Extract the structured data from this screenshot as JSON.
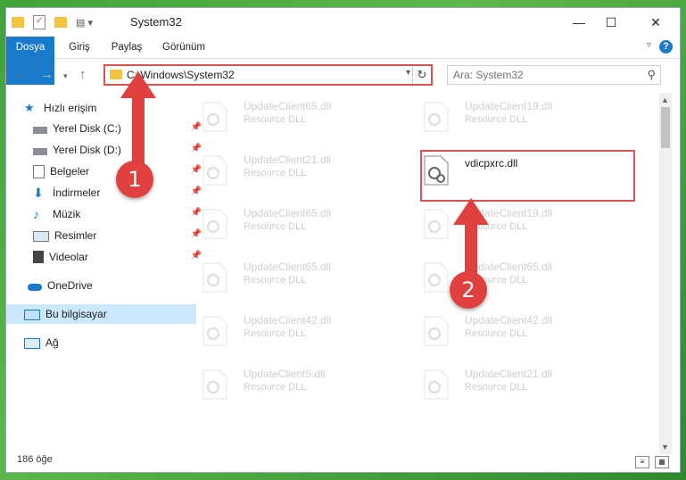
{
  "window": {
    "title": "System32",
    "minimize": "—",
    "maximize": "☐",
    "close": "✕"
  },
  "ribbon": {
    "tabs": [
      "Dosya",
      "Giriş",
      "Paylaş",
      "Görünüm"
    ],
    "help": "?"
  },
  "address": {
    "path": "C:\\Windows\\System32",
    "search_placeholder": "Ara: System32"
  },
  "nav": {
    "items": [
      {
        "label": "Hızlı erişim",
        "icon": "star-icon"
      },
      {
        "label": "Yerel Disk (C:)",
        "icon": "drive-icon",
        "pinned": true
      },
      {
        "label": "Yerel Disk (D:)",
        "icon": "drive-icon",
        "pinned": true
      },
      {
        "label": "Belgeler",
        "icon": "documents-icon",
        "pinned": true
      },
      {
        "label": "İndirmeler",
        "icon": "downloads-icon",
        "pinned": true
      },
      {
        "label": "Müzik",
        "icon": "music-icon",
        "pinned": true
      },
      {
        "label": "Resimler",
        "icon": "pictures-icon",
        "pinned": true
      },
      {
        "label": "Videolar",
        "icon": "videos-icon",
        "pinned": true
      },
      {
        "label": "OneDrive",
        "icon": "onedrive-icon"
      },
      {
        "label": "Bu bilgisayar",
        "icon": "computer-icon"
      },
      {
        "label": "Ağ",
        "icon": "network-icon"
      }
    ]
  },
  "files": {
    "type_label": "Resource DLL",
    "left": [
      "UpdateClient65.dll",
      "UpdateClient21.dll",
      "UpdateClient65.dll",
      "UpdateClient65.dll",
      "UpdateClient42.dll",
      "UpdateClient5.dll"
    ],
    "right": [
      "UpdateClient19.dll",
      "vdicpxrc.dll",
      "UpdateClient19.dll",
      "UpdateClient65.dll",
      "UpdateClient42.dll",
      "UpdateClient21.dll"
    ],
    "highlighted": "vdicpxrc.dll"
  },
  "status": {
    "count": "186 öğe"
  },
  "annotations": {
    "step1": "1",
    "step2": "2"
  },
  "colors": {
    "accent": "#1979ca",
    "highlight": "#d9534f",
    "selection": "#cce8ff"
  }
}
